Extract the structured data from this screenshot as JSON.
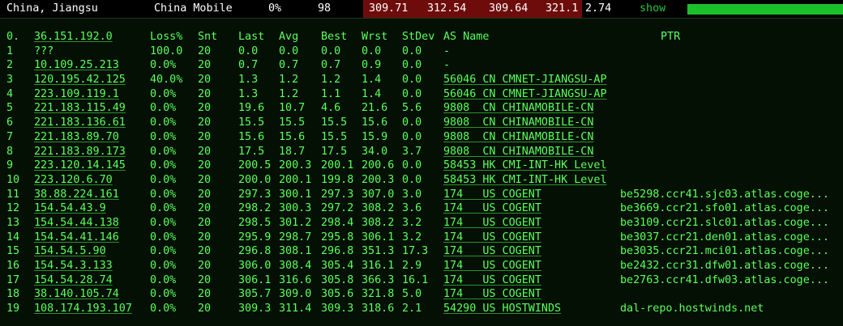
{
  "summary": {
    "location": "China, Jiangsu",
    "isp": "China Mobile",
    "loss": "0%",
    "sent": "98",
    "last": "309.71",
    "avg": "312.54",
    "best": "309.64",
    "worst": "321.1",
    "stdev": "2.74",
    "show_label": "show",
    "bar_fill_fraction": 1.0
  },
  "colors": {
    "background": "#031003",
    "text": "#5cff5c",
    "highlight_red": "#6e0c0c",
    "bar_green": "#19c02a"
  },
  "header": {
    "idx": "0.",
    "host": "36.151.192.0",
    "loss": "Loss%",
    "snt": "Snt",
    "last": "Last",
    "avg": "Avg",
    "best": "Best",
    "wrst": "Wrst",
    "stdev": "StDev",
    "as_name": "AS Name",
    "ptr": "PTR"
  },
  "rows": [
    {
      "idx": "1",
      "host": "???",
      "loss": "100.0",
      "snt": "20",
      "last": "0.0",
      "avg": "0.0",
      "best": "0.0",
      "wrst": "0.0",
      "stdev": "0.0",
      "as_name": "-",
      "ptr": ""
    },
    {
      "idx": "2",
      "host": "10.109.25.213",
      "loss": "0.0%",
      "snt": "20",
      "last": "0.7",
      "avg": "0.7",
      "best": "0.7",
      "wrst": "0.9",
      "stdev": "0.0",
      "as_name": "-",
      "ptr": ""
    },
    {
      "idx": "3",
      "host": "120.195.42.125",
      "loss": "40.0%",
      "snt": "20",
      "last": "1.3",
      "avg": "1.2",
      "best": "1.2",
      "wrst": "1.4",
      "stdev": "0.0",
      "as_name": "56046 CN CMNET-JIANGSU-AP",
      "ptr": ""
    },
    {
      "idx": "4",
      "host": "223.109.119.1",
      "loss": "0.0%",
      "snt": "20",
      "last": "1.3",
      "avg": "1.2",
      "best": "1.1",
      "wrst": "1.4",
      "stdev": "0.0",
      "as_name": "56046 CN CMNET-JIANGSU-AP",
      "ptr": ""
    },
    {
      "idx": "5",
      "host": "221.183.115.49",
      "loss": "0.0%",
      "snt": "20",
      "last": "19.6",
      "avg": "10.7",
      "best": "4.6",
      "wrst": "21.6",
      "stdev": "5.6",
      "as_name": "9808  CN CHINAMOBILE-CN",
      "ptr": ""
    },
    {
      "idx": "6",
      "host": "221.183.136.61",
      "loss": "0.0%",
      "snt": "20",
      "last": "15.5",
      "avg": "15.5",
      "best": "15.5",
      "wrst": "15.6",
      "stdev": "0.0",
      "as_name": "9808  CN CHINAMOBILE-CN",
      "ptr": ""
    },
    {
      "idx": "7",
      "host": "221.183.89.70",
      "loss": "0.0%",
      "snt": "20",
      "last": "15.6",
      "avg": "15.6",
      "best": "15.5",
      "wrst": "15.9",
      "stdev": "0.0",
      "as_name": "9808  CN CHINAMOBILE-CN",
      "ptr": ""
    },
    {
      "idx": "8",
      "host": "221.183.89.173",
      "loss": "0.0%",
      "snt": "20",
      "last": "17.5",
      "avg": "18.7",
      "best": "17.5",
      "wrst": "34.0",
      "stdev": "3.7",
      "as_name": "9808  CN CHINAMOBILE-CN",
      "ptr": ""
    },
    {
      "idx": "9",
      "host": "223.120.14.145",
      "loss": "0.0%",
      "snt": "20",
      "last": "200.5",
      "avg": "200.3",
      "best": "200.1",
      "wrst": "200.6",
      "stdev": "0.0",
      "as_name": "58453 HK CMI-INT-HK Level",
      "ptr": ""
    },
    {
      "idx": "10",
      "host": "223.120.6.70",
      "loss": "0.0%",
      "snt": "20",
      "last": "200.0",
      "avg": "200.1",
      "best": "199.8",
      "wrst": "200.3",
      "stdev": "0.0",
      "as_name": "58453 HK CMI-INT-HK Level",
      "ptr": ""
    },
    {
      "idx": "11",
      "host": "38.88.224.161",
      "loss": "0.0%",
      "snt": "20",
      "last": "297.3",
      "avg": "300.1",
      "best": "297.3",
      "wrst": "307.0",
      "stdev": "3.0",
      "as_name": "174   US COGENT",
      "ptr": "be5298.ccr41.sjc03.atlas.coge..."
    },
    {
      "idx": "12",
      "host": "154.54.43.9",
      "loss": "0.0%",
      "snt": "20",
      "last": "298.2",
      "avg": "300.3",
      "best": "297.2",
      "wrst": "308.2",
      "stdev": "3.6",
      "as_name": "174   US COGENT",
      "ptr": "be3669.ccr21.sfo01.atlas.coge..."
    },
    {
      "idx": "13",
      "host": "154.54.44.138",
      "loss": "0.0%",
      "snt": "20",
      "last": "298.5",
      "avg": "301.2",
      "best": "298.4",
      "wrst": "308.2",
      "stdev": "3.2",
      "as_name": "174   US COGENT",
      "ptr": "be3109.ccr21.slc01.atlas.coge..."
    },
    {
      "idx": "14",
      "host": "154.54.41.146",
      "loss": "0.0%",
      "snt": "20",
      "last": "295.9",
      "avg": "298.7",
      "best": "295.8",
      "wrst": "306.1",
      "stdev": "3.2",
      "as_name": "174   US COGENT",
      "ptr": "be3037.ccr21.den01.atlas.coge..."
    },
    {
      "idx": "15",
      "host": "154.54.5.90",
      "loss": "0.0%",
      "snt": "20",
      "last": "296.8",
      "avg": "308.1",
      "best": "296.8",
      "wrst": "351.3",
      "stdev": "17.3",
      "as_name": "174   US COGENT",
      "ptr": "be3035.ccr21.mci01.atlas.coge..."
    },
    {
      "idx": "16",
      "host": "154.54.3.133",
      "loss": "0.0%",
      "snt": "20",
      "last": "306.0",
      "avg": "308.4",
      "best": "305.4",
      "wrst": "316.1",
      "stdev": "2.9",
      "as_name": "174   US COGENT",
      "ptr": "be2432.ccr31.dfw01.atlas.coge..."
    },
    {
      "idx": "17",
      "host": "154.54.28.74",
      "loss": "0.0%",
      "snt": "20",
      "last": "306.1",
      "avg": "316.6",
      "best": "305.8",
      "wrst": "366.3",
      "stdev": "16.1",
      "as_name": "174   US COGENT",
      "ptr": "be2763.ccr41.dfw03.atlas.coge..."
    },
    {
      "idx": "18",
      "host": "38.140.105.74",
      "loss": "0.0%",
      "snt": "20",
      "last": "305.7",
      "avg": "309.0",
      "best": "305.6",
      "wrst": "321.8",
      "stdev": "5.0",
      "as_name": "174   US COGENT",
      "ptr": ""
    },
    {
      "idx": "19",
      "host": "108.174.193.107",
      "loss": "0.0%",
      "snt": "20",
      "last": "309.3",
      "avg": "311.4",
      "best": "309.3",
      "wrst": "318.6",
      "stdev": "2.1",
      "as_name": "54290 US HOSTWINDS",
      "ptr": "dal-repo.hostwinds.net"
    }
  ]
}
